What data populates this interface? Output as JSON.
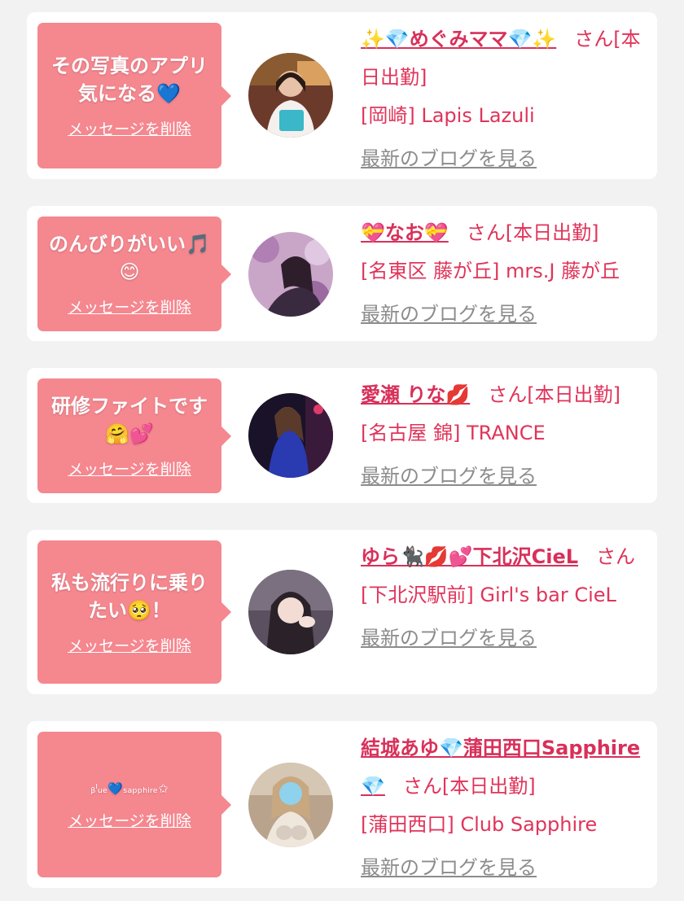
{
  "messages": [
    {
      "comment": "その写真のアプリ\n気になる💙",
      "delete_label": "メッセージを削除",
      "name": "✨💎めぐみママ💎✨",
      "suffix": "さん[本日出勤]",
      "shop": "[岡崎] Lapis Lazuli",
      "blog_label": "最新のブログを見る"
    },
    {
      "comment": "のんびりがいい🎵\n😊",
      "delete_label": "メッセージを削除",
      "name": "💝なお💝",
      "suffix": "さん[本日出勤]",
      "shop": "[名東区 藤が丘] mrs.J 藤が丘",
      "blog_label": "最新のブログを見る"
    },
    {
      "comment": "研修ファイトです\n🤗💕",
      "delete_label": "メッセージを削除",
      "name": "愛瀬 りな💋",
      "suffix": "さん[本日出勤]",
      "shop": "[名古屋 錦] TRANCE",
      "blog_label": "最新のブログを見る"
    },
    {
      "comment": "私も流行りに乗り\nたい🥺！",
      "delete_label": "メッセージを削除",
      "name": "ゆら🐈‍⬛💋💕下北沢CieL",
      "suffix": "さん",
      "shop": "[下北沢駅前] Girl's bar CieL",
      "blog_label": "最新のブログを見る"
    },
    {
      "comment": "ᵦˡᵤₑ💙ₛₐₚₚₕᵢᵣₑ✩",
      "delete_label": "メッセージを削除",
      "name": "結城あゆ💎蒲田西口Sapphire💎",
      "suffix": "さん[本日出勤]",
      "shop": "[蒲田西口] Club Sapphire",
      "blog_label": "最新のブログを見る"
    }
  ],
  "colors": {
    "background": "#f2f2f2",
    "card": "#ffffff",
    "bubble": "#f5878f",
    "accent_text": "#e0345a",
    "link_gray": "#8c8c8c"
  }
}
